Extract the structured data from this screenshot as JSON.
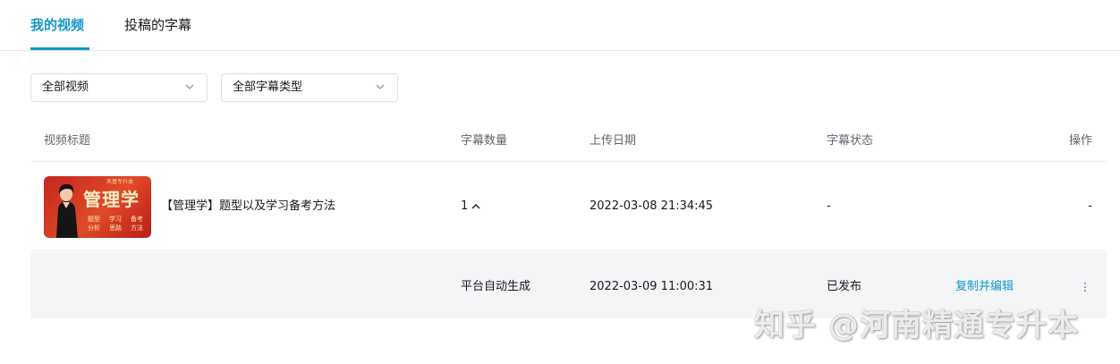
{
  "tabs": [
    {
      "label": "我的视频",
      "active": true
    },
    {
      "label": "投稿的字幕",
      "active": false
    }
  ],
  "filters": {
    "video_filter": "全部视频",
    "subtitle_type_filter": "全部字幕类型"
  },
  "table": {
    "headers": {
      "title": "视频标题",
      "count": "字幕数量",
      "upload_date": "上传日期",
      "status": "字幕状态",
      "actions": "操作"
    },
    "video_row": {
      "thumbnail": {
        "title": "管理学",
        "top_text": "天基专升本",
        "sub_items": [
          "题型",
          "学习",
          "备考",
          "分析",
          "思路",
          "方法"
        ]
      },
      "title": "【管理学】题型以及学习备考方法",
      "count": "1",
      "upload_date": "2022-03-08 21:34:45",
      "status": "-",
      "action": "-"
    },
    "subtitle_row": {
      "source": "平台自动生成",
      "date": "2022-03-09 11:00:31",
      "status": "已发布",
      "action_link": "复制并编辑"
    }
  },
  "watermark": "知乎 @河南精通专升本",
  "colors": {
    "accent": "#1296c8",
    "text": "#18191c",
    "muted": "#61666d",
    "row_bg": "#f4f5f7"
  }
}
